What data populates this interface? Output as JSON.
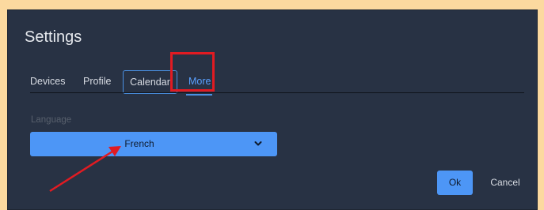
{
  "dialog": {
    "title": "Settings"
  },
  "tabs": [
    {
      "label": "Devices"
    },
    {
      "label": "Profile"
    },
    {
      "label": "Calendar"
    },
    {
      "label": "More",
      "active": true
    }
  ],
  "language": {
    "label": "Language",
    "selected": "French"
  },
  "buttons": {
    "ok": "Ok",
    "cancel": "Cancel"
  },
  "colors": {
    "page_background": "#fcd99f",
    "dialog_background": "#283244",
    "accent": "#4d96f6",
    "highlight": "#e11b22"
  }
}
